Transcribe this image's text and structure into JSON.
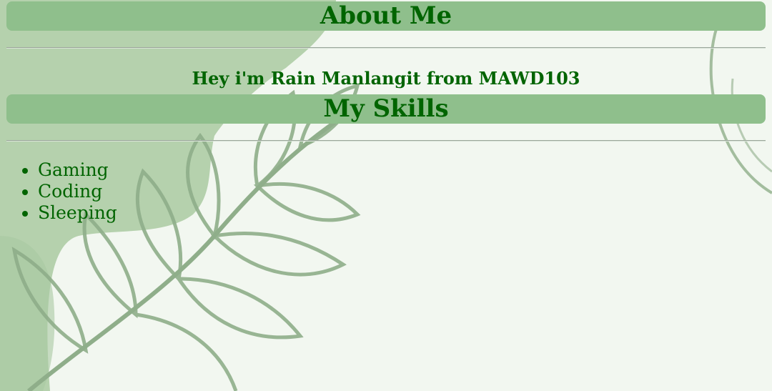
{
  "about": {
    "title": "About Me",
    "intro": "Hey i'm Rain Manlangit from MAWD103"
  },
  "skills": {
    "title": "My Skills",
    "items": [
      "Gaming",
      "Coding",
      "Sleeping"
    ]
  },
  "colors": {
    "heading_bg": "#8fbf8c",
    "text": "#006400",
    "page_bg": "#f2f7f0",
    "leaf": "#8fae8a",
    "blob": "#b5d1ad"
  }
}
